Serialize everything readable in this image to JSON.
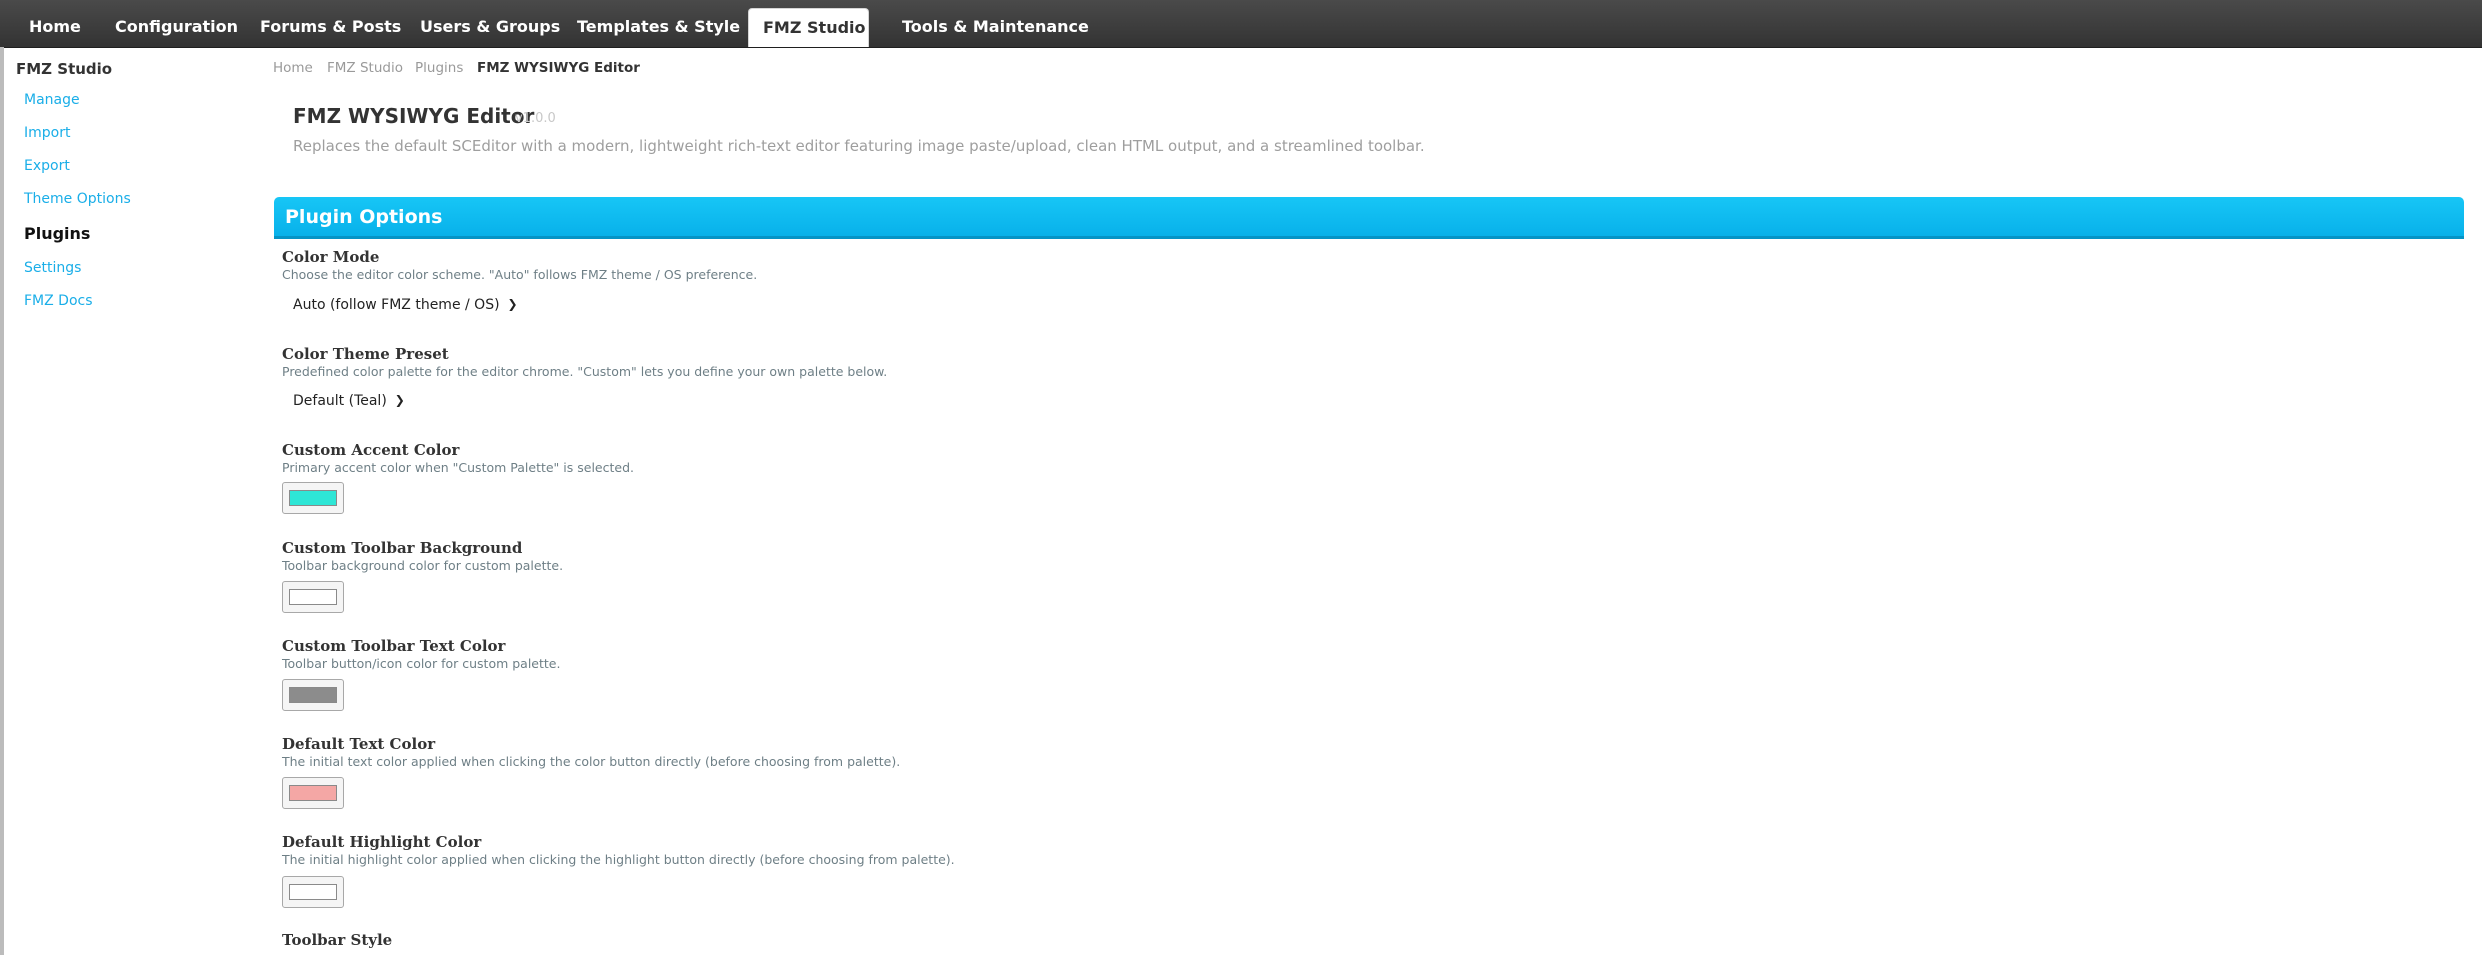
{
  "nav": {
    "tabs": [
      {
        "label": "Home"
      },
      {
        "label": "Configuration"
      },
      {
        "label": "Forums & Posts"
      },
      {
        "label": "Users & Groups"
      },
      {
        "label": "Templates & Style"
      },
      {
        "label": "FMZ Studio",
        "active": true
      },
      {
        "label": "Tools & Maintenance"
      }
    ]
  },
  "sidebar": {
    "title": "FMZ Studio",
    "items": [
      {
        "label": "Manage"
      },
      {
        "label": "Import"
      },
      {
        "label": "Export"
      },
      {
        "label": "Theme Options"
      },
      {
        "label": "Plugins",
        "active": true
      },
      {
        "label": "Settings"
      },
      {
        "label": "FMZ Docs"
      }
    ]
  },
  "breadcrumb": [
    "Home",
    "FMZ Studio",
    "Plugins",
    "FMZ WYSIWYG Editor"
  ],
  "page": {
    "title": "FMZ WYSIWYG Editor",
    "version": "v1.0.0",
    "description": "Replaces the default SCEditor with a modern, lightweight rich-text editor featuring image paste/upload, clean HTML output, and a streamlined toolbar."
  },
  "panel": {
    "title": "Plugin Options",
    "options": [
      {
        "label": "Color Mode",
        "desc": "Choose the editor color scheme. \"Auto\" follows FMZ theme / OS preference.",
        "type": "select",
        "value": "Auto (follow FMZ theme / OS)"
      },
      {
        "label": "Color Theme Preset",
        "desc": "Predefined color palette for the editor chrome. \"Custom\" lets you define your own palette below.",
        "type": "select",
        "value": "Default (Teal)"
      },
      {
        "label": "Custom Accent Color",
        "desc": "Primary accent color when \"Custom Palette\" is selected.",
        "type": "color",
        "color": "#2ee6d6"
      },
      {
        "label": "Custom Toolbar Background",
        "desc": "Toolbar background color for custom palette.",
        "type": "color",
        "color": "#ffffff"
      },
      {
        "label": "Custom Toolbar Text Color",
        "desc": "Toolbar button/icon color for custom palette.",
        "type": "color",
        "color": "#8c8c8c"
      },
      {
        "label": "Default Text Color",
        "desc": "The initial text color applied when clicking the color button directly (before choosing from palette).",
        "type": "color",
        "color": "#f4a7a5"
      },
      {
        "label": "Default Highlight Color",
        "desc": "The initial highlight color applied when clicking the highlight button directly (before choosing from palette).",
        "type": "color",
        "color": "#ffffff"
      },
      {
        "label": "Toolbar Style",
        "desc": "",
        "type": "partial"
      }
    ]
  },
  "colors": {
    "accent": "#08b1ea",
    "link": "#1aaee8",
    "nav_bg": "#3d3d3d"
  }
}
